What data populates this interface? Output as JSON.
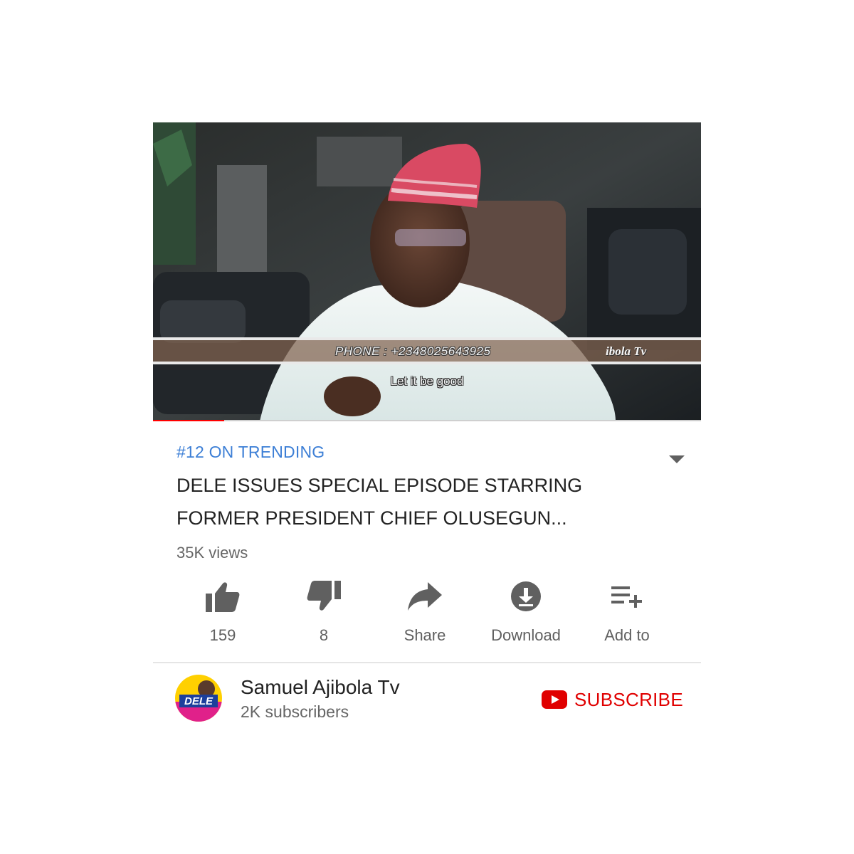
{
  "video": {
    "overlay_phone": "PHONE : +2348025643925",
    "overlay_watermark": "ibola Tv",
    "subtitle": "Let it be good",
    "progress_fraction": 0.13
  },
  "meta": {
    "trending": "#12 ON TRENDING",
    "title": "DELE ISSUES SPECIAL EPISODE STARRING FORMER PRESIDENT CHIEF OLUSEGUN...",
    "title_line1": "DELE ISSUES SPECIAL EPISODE STARRING",
    "title_line2": "FORMER PRESIDENT CHIEF OLUSEGUN...",
    "views": "35K views",
    "expand_icon": "chevron-down-icon"
  },
  "actions": [
    {
      "id": "like",
      "icon": "thumbs-up-icon",
      "label": "159"
    },
    {
      "id": "dislike",
      "icon": "thumbs-down-icon",
      "label": "8"
    },
    {
      "id": "share",
      "icon": "share-arrow-icon",
      "label": "Share"
    },
    {
      "id": "download",
      "icon": "download-icon",
      "label": "Download"
    },
    {
      "id": "add_to",
      "icon": "playlist-add-icon",
      "label": "Add to"
    }
  ],
  "channel": {
    "name": "Samuel Ajibola Tv",
    "subscribers": "2K subscribers",
    "avatar_text": "DELE",
    "subscribe_label": "SUBSCRIBE",
    "subscribe_icon": "youtube-logo-icon"
  },
  "colors": {
    "accent_blue": "#3d7fd6",
    "subscribe_red": "#e00000",
    "progress_red": "#ff0000",
    "icon_gray": "#606060"
  }
}
